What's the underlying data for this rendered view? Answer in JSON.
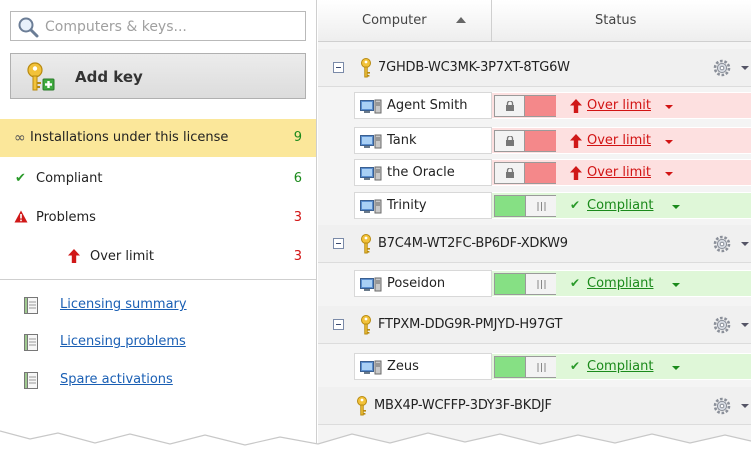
{
  "search": {
    "placeholder": "Computers & keys..."
  },
  "add_key": {
    "label": "Add key"
  },
  "filters": {
    "installations": {
      "label": "Installations under this license",
      "count": "9",
      "icon": "infinity-icon"
    },
    "compliant": {
      "label": "Compliant",
      "count": "6",
      "icon": "checkmark-icon"
    },
    "problems": {
      "label": "Problems",
      "count": "3",
      "icon": "warning-icon"
    },
    "over_limit": {
      "label": "Over limit",
      "count": "3",
      "icon": "up-arrow-icon"
    }
  },
  "reports": [
    {
      "label": "Licensing summary"
    },
    {
      "label": "Licensing problems"
    },
    {
      "label": "Spare activations"
    }
  ],
  "table": {
    "columns": {
      "computer": "Computer",
      "status": "Status"
    },
    "keys": [
      {
        "key": "7GHDB-WC3MK-3P7XT-8TG6W",
        "computers": [
          {
            "name": "Agent Smith",
            "status": "Over limit",
            "state": "bad"
          },
          {
            "name": "Tank",
            "status": "Over limit",
            "state": "bad"
          },
          {
            "name": "the Oracle",
            "status": "Over limit",
            "state": "bad"
          },
          {
            "name": "Trinity",
            "status": "Compliant",
            "state": "good"
          }
        ]
      },
      {
        "key": "B7C4M-WT2FC-BP6DF-XDKW9",
        "computers": [
          {
            "name": "Poseidon",
            "status": "Compliant",
            "state": "good"
          }
        ]
      },
      {
        "key": "FTPXM-DDG9R-PMJYD-H97GT",
        "computers": [
          {
            "name": "Zeus",
            "status": "Compliant",
            "state": "good"
          }
        ]
      },
      {
        "key": "MBX4P-WCFFP-3DY3F-BKDJF",
        "computers": []
      }
    ]
  },
  "colors": {
    "selected_filter": "#fbe79a",
    "over_limit": "#d21414",
    "compliant": "#1b8a1b",
    "bad_row": "#fde0e0",
    "good_row": "#dff7d8",
    "link": "#1a5fb4"
  }
}
